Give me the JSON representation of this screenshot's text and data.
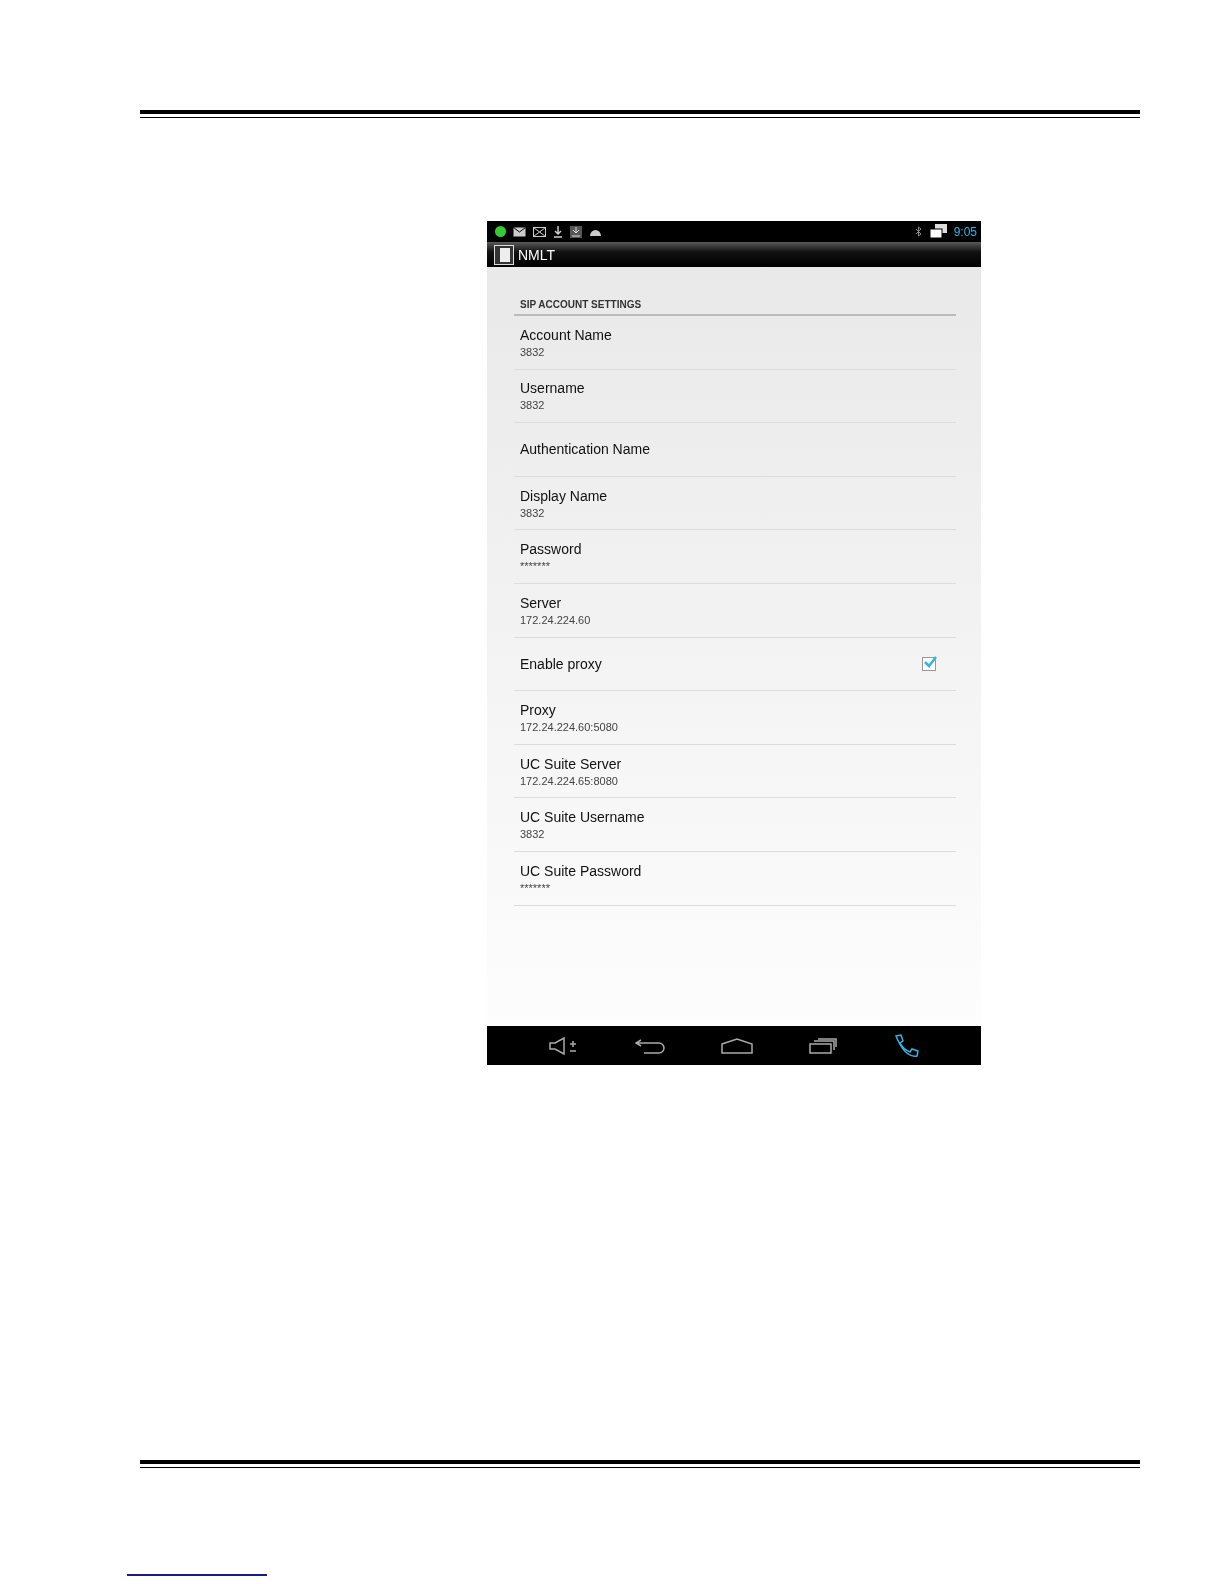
{
  "status_bar": {
    "time": "9:05"
  },
  "action_bar": {
    "title": "NMLT"
  },
  "section": {
    "title": "SIP ACCOUNT SETTINGS"
  },
  "settings": [
    {
      "kind": "text",
      "title": "Account Name",
      "summary": "3832"
    },
    {
      "kind": "text",
      "title": "Username",
      "summary": "3832"
    },
    {
      "kind": "text",
      "title": "Authentication Name"
    },
    {
      "kind": "text",
      "title": "Display Name",
      "summary": "3832"
    },
    {
      "kind": "text",
      "title": "Password",
      "summary": "*******"
    },
    {
      "kind": "text",
      "title": "Server",
      "summary": "172.24.224.60"
    },
    {
      "kind": "checkbox",
      "title": "Enable proxy",
      "checked": true
    },
    {
      "kind": "text",
      "title": "Proxy",
      "summary": "172.24.224.60:5080"
    },
    {
      "kind": "text",
      "title": "UC Suite Server",
      "summary": "172.24.224.65:8080"
    },
    {
      "kind": "text",
      "title": "UC Suite Username",
      "summary": "3832"
    },
    {
      "kind": "text",
      "title": "UC Suite Password",
      "summary": "*******"
    }
  ]
}
